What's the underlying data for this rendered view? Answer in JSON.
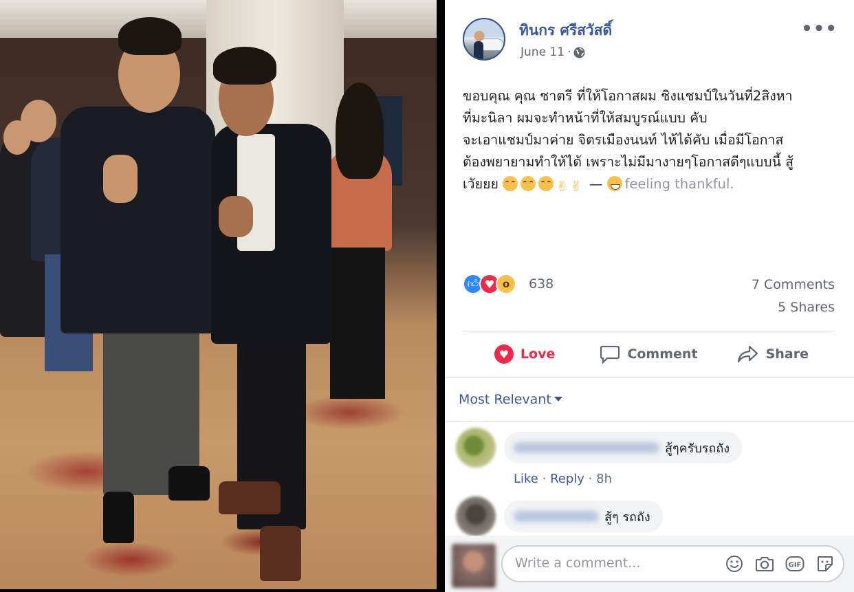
{
  "post": {
    "author": "ทินกร ศรีสวัสดิ์",
    "date": "June 11",
    "separator": "·",
    "more_icon": "•••",
    "text_main": "ขอบคุณ คุณ ชาตรี ที่ให้โอกาสผม ชิงแชมป์ในวันที่2สิงหา\nที่มะนิลา ผมจะทำหน้าที่ให้สมบูรณ์แบบ คับ\nจะเอาแชมป์มาค่าย จิตรเมืองนนท์ ไห้ได้คับ เมื่อมีโอกาส\nต้องพยายามทำให้ได้ เพราะไม่มีมางายๆโอกาสดีๆแบบนี้ สู้\nเวัยยย ",
    "emojis": [
      "smile",
      "smile",
      "smile",
      "victory",
      "victory"
    ],
    "dash": "—",
    "feeling_emoji": "grin",
    "feeling": "feeling thankful."
  },
  "reactions": {
    "icons": [
      "like-icon",
      "love-icon",
      "wow-icon"
    ],
    "count": "638",
    "comments": "7 Comments",
    "shares": "5 Shares"
  },
  "actions": {
    "love": "Love",
    "comment": "Comment",
    "share": "Share"
  },
  "comments": {
    "sort_label": "Most Relevant",
    "items": [
      {
        "text": "สู้ๆครับรถถัง",
        "like": "Like",
        "reply": "Reply",
        "dot": "·",
        "time": "8h"
      },
      {
        "text": "สู้ๆ รถถัง"
      }
    ]
  },
  "composer": {
    "placeholder": "Write a comment...",
    "icons": [
      "emoji-icon",
      "camera-icon",
      "gif-icon",
      "sticker-icon"
    ],
    "gif_label": "GIF"
  },
  "colors": {
    "link_blue": "#385898",
    "love_red": "#f0284a",
    "like_blue": "#2d88ff",
    "text": "#1c1e21",
    "muted": "#606770"
  }
}
